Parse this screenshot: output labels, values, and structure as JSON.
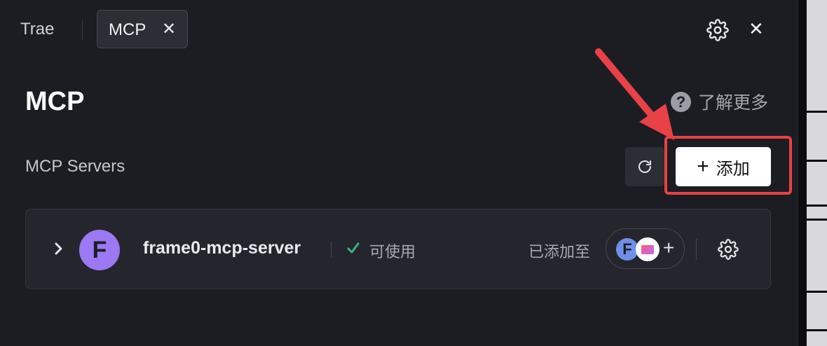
{
  "tabs": [
    {
      "label": "Trae"
    },
    {
      "label": "MCP",
      "close_icon": "close-icon"
    }
  ],
  "header_icons": {
    "settings": "gear-icon",
    "close": "close-icon"
  },
  "page": {
    "title": "MCP",
    "learn_more": {
      "icon": "question-circle-icon",
      "label": "了解更多"
    }
  },
  "section": {
    "title": "MCP Servers",
    "refresh_icon": "refresh-icon",
    "add_button": {
      "icon": "plus-icon",
      "label": "添加"
    }
  },
  "servers": [
    {
      "avatar_letter": "F",
      "name": "frame0-mcp-server",
      "status": {
        "icon": "check-icon",
        "label": "可使用",
        "color": "#3fb27f"
      },
      "added_to_label": "已添加至",
      "agents": [
        {
          "letter": "F",
          "color": "#6f8fe8"
        },
        {
          "icon": "mail-icon"
        }
      ],
      "add_agent_icon": "plus-icon",
      "settings_icon": "gear-icon"
    }
  ],
  "colors": {
    "background": "#1c1d22",
    "card": "#25262d",
    "highlight": "#e84146",
    "avatar": "#9a79f2"
  }
}
